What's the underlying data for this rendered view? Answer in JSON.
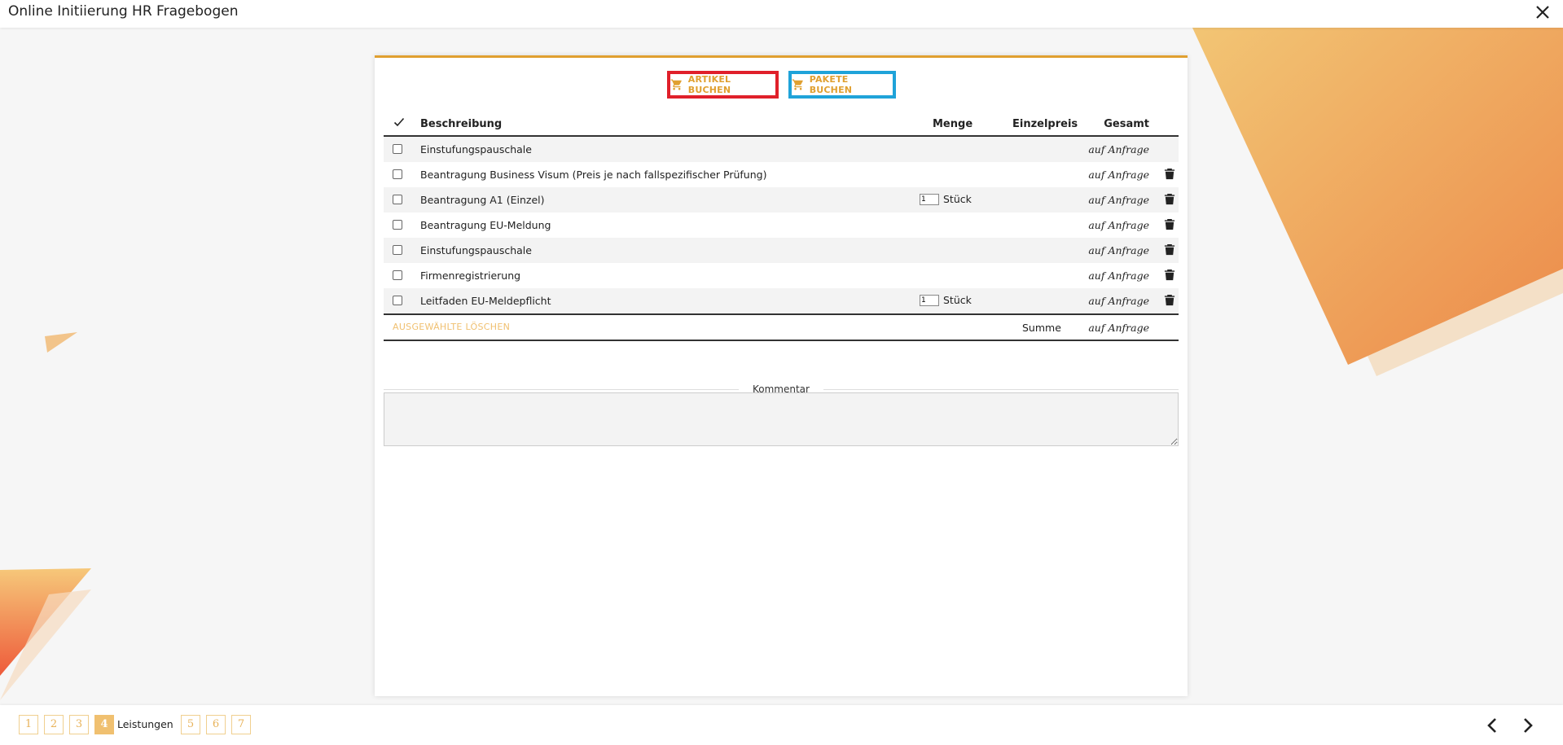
{
  "window": {
    "title": "Online Initiierung HR Fragebogen"
  },
  "buttons": {
    "artikel": "ARTIKEL BUCHEN",
    "pakete": "PAKETE BUCHEN"
  },
  "table": {
    "headers": {
      "beschreibung": "Beschreibung",
      "menge": "Menge",
      "einzelpreis": "Einzelpreis",
      "gesamt": "Gesamt"
    },
    "rows": [
      {
        "desc": "Einstufungspauschale",
        "qty": "",
        "unit": "",
        "total": "auf Anfrage",
        "trash": false
      },
      {
        "desc": "Beantragung Business Visum (Preis je nach fallspezifischer Prüfung)",
        "qty": "",
        "unit": "",
        "total": "auf Anfrage",
        "trash": true
      },
      {
        "desc": "Beantragung A1 (Einzel)",
        "qty": "1",
        "unit": "Stück",
        "total": "auf Anfrage",
        "trash": true
      },
      {
        "desc": "Beantragung EU-Meldung",
        "qty": "",
        "unit": "",
        "total": "auf Anfrage",
        "trash": true
      },
      {
        "desc": "Einstufungspauschale",
        "qty": "",
        "unit": "",
        "total": "auf Anfrage",
        "trash": true
      },
      {
        "desc": "Firmenregistrierung",
        "qty": "",
        "unit": "",
        "total": "auf Anfrage",
        "trash": true
      },
      {
        "desc": "Leitfaden EU-Meldepflicht",
        "qty": "1",
        "unit": "Stück",
        "total": "auf Anfrage",
        "trash": true
      }
    ],
    "delete_selected": "AUSGEWÄHLTE LÖSCHEN",
    "sum_label": "Summe",
    "sum_value": "auf Anfrage"
  },
  "comment": {
    "label": "Kommentar",
    "value": ""
  },
  "footer": {
    "pages": [
      "1",
      "2",
      "3",
      "4",
      "5",
      "6",
      "7"
    ],
    "active_page": "4",
    "active_label": "Leistungen"
  },
  "colors": {
    "accent": "#e0a030",
    "artikel_border": "#e0202a",
    "pakete_border": "#1fa3d9"
  },
  "icons": {
    "cart": "cart-icon",
    "trash": "trash-icon",
    "close": "close-icon",
    "check": "check-icon",
    "prev": "chevron-left-icon",
    "next": "chevron-right-icon"
  }
}
